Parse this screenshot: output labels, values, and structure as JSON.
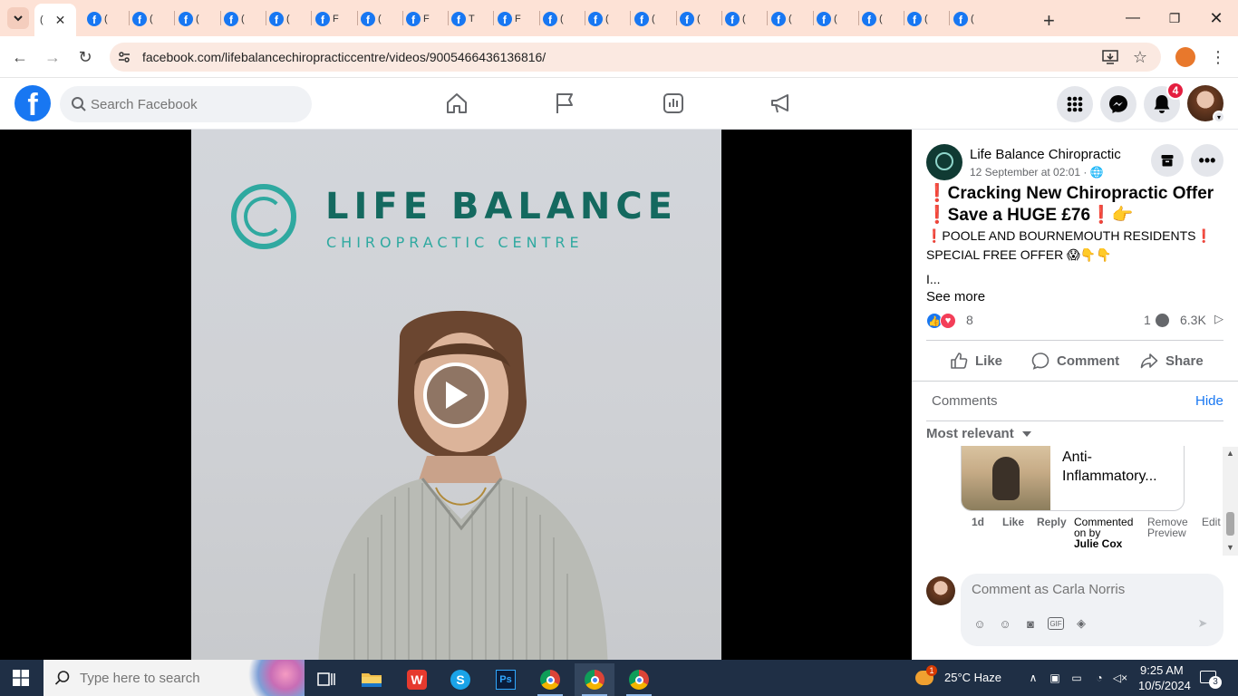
{
  "browser": {
    "active_tab_label": "(",
    "tab_labels": [
      "(",
      "(",
      "(",
      "(",
      "(",
      "F",
      "(",
      "F",
      "T",
      "F",
      "(",
      "(",
      "(",
      "(",
      "(",
      "(",
      "(",
      "(",
      "(",
      "("
    ],
    "url": "facebook.com/lifebalancechiropracticcentre/videos/9005466436136816/",
    "theme_color": "#fde2d6"
  },
  "fb_header": {
    "search_placeholder": "Search Facebook",
    "notification_count": "4",
    "brand_color": "#1877f2"
  },
  "video": {
    "logo_title": "LIFE BALANCE",
    "logo_subtitle": "CHIROPRACTIC CENTRE"
  },
  "post": {
    "page_name": "Life Balance Chiropractic",
    "time": "12 September at 02:01 · ",
    "headline_line1": "❗Cracking New Chiropractic Offer",
    "headline_line2": "❗Save a HUGE £76❗👉",
    "body_line1": "❗POOLE AND BOURNEMOUTH RESIDENTS❗",
    "body_line2": "SPECIAL FREE OFFER 😱👇👇",
    "body_line3": "I...",
    "see_more": "See more",
    "reaction_count": "8",
    "comment_count": "1",
    "view_count": "6.3K",
    "actions": {
      "like": "Like",
      "comment": "Comment",
      "share": "Share"
    }
  },
  "comments": {
    "label": "Comments",
    "hide": "Hide",
    "sort": "Most relevant",
    "preview_title_1": "Anti-",
    "preview_title_2": "Inflammatory...",
    "meta": {
      "age": "1d",
      "like": "Like",
      "reply": "Reply",
      "commented_on_1": "Commented",
      "commented_on_2": "on by",
      "commenter": "Julie Cox",
      "remove_1": "Remove",
      "remove_2": "Preview",
      "edit": "Edit"
    },
    "input_placeholder": "Comment as Carla Norris"
  },
  "taskbar": {
    "search_placeholder": "Type here to search",
    "weather_badge": "1",
    "weather": "25°C  Haze",
    "time": "9:25 AM",
    "date": "10/5/2024",
    "notification_count": "3"
  }
}
